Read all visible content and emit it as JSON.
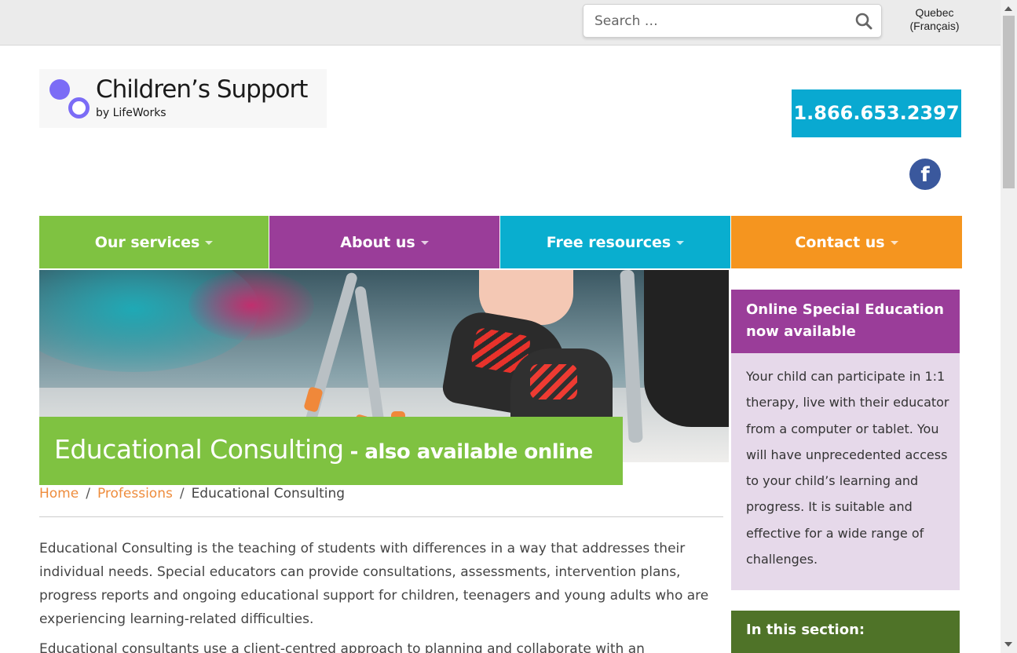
{
  "topbar": {
    "search_placeholder": "Search …",
    "language_link_line1": "Quebec",
    "language_link_line2": "(Français)"
  },
  "header": {
    "logo_name": "Children’s Support",
    "logo_byline": "by LifeWorks",
    "phone": "1.866.653.2397",
    "social_icon": "facebook-icon",
    "social_glyph": "f"
  },
  "nav": {
    "items": [
      {
        "label": "Our services",
        "color": "#7fc241"
      },
      {
        "label": "About us",
        "color": "#9a3d99"
      },
      {
        "label": "Free resources",
        "color": "#09aecf"
      },
      {
        "label": "Contact us",
        "color": "#f5951f"
      }
    ]
  },
  "hero": {
    "title": "Educational Consulting",
    "title_suffix": "- also available online"
  },
  "breadcrumb": {
    "home": "Home",
    "separator": "/",
    "section": "Professions",
    "current": "Educational Consulting"
  },
  "content": {
    "paragraph1": "Educational Consulting is the teaching of students with differences in a way that addresses their individual needs. Special educators can provide consultations, assessments, intervention plans, progress reports and ongoing educational support for children, teenagers and young adults who are experiencing learning-related difficulties.",
    "paragraph2": "Educational consultants use a client-centred approach to planning and collaborate with an"
  },
  "sidebar": {
    "promo_title": "Online Special Education now available",
    "promo_text": "Your child can participate in 1:1 therapy, live with their educator from a computer or tablet. You will have unprecedented access to your child’s learning and progress. It is suitable and effective for a wide range of challenges.",
    "section_title": "In this section:"
  },
  "colors": {
    "green": "#7fc241",
    "purple": "#9a3d99",
    "cyan": "#09aecf",
    "orange": "#f5951f",
    "dark_green": "#4f7328",
    "link_orange": "#ee8c3c",
    "facebook_blue": "#3a589d"
  }
}
